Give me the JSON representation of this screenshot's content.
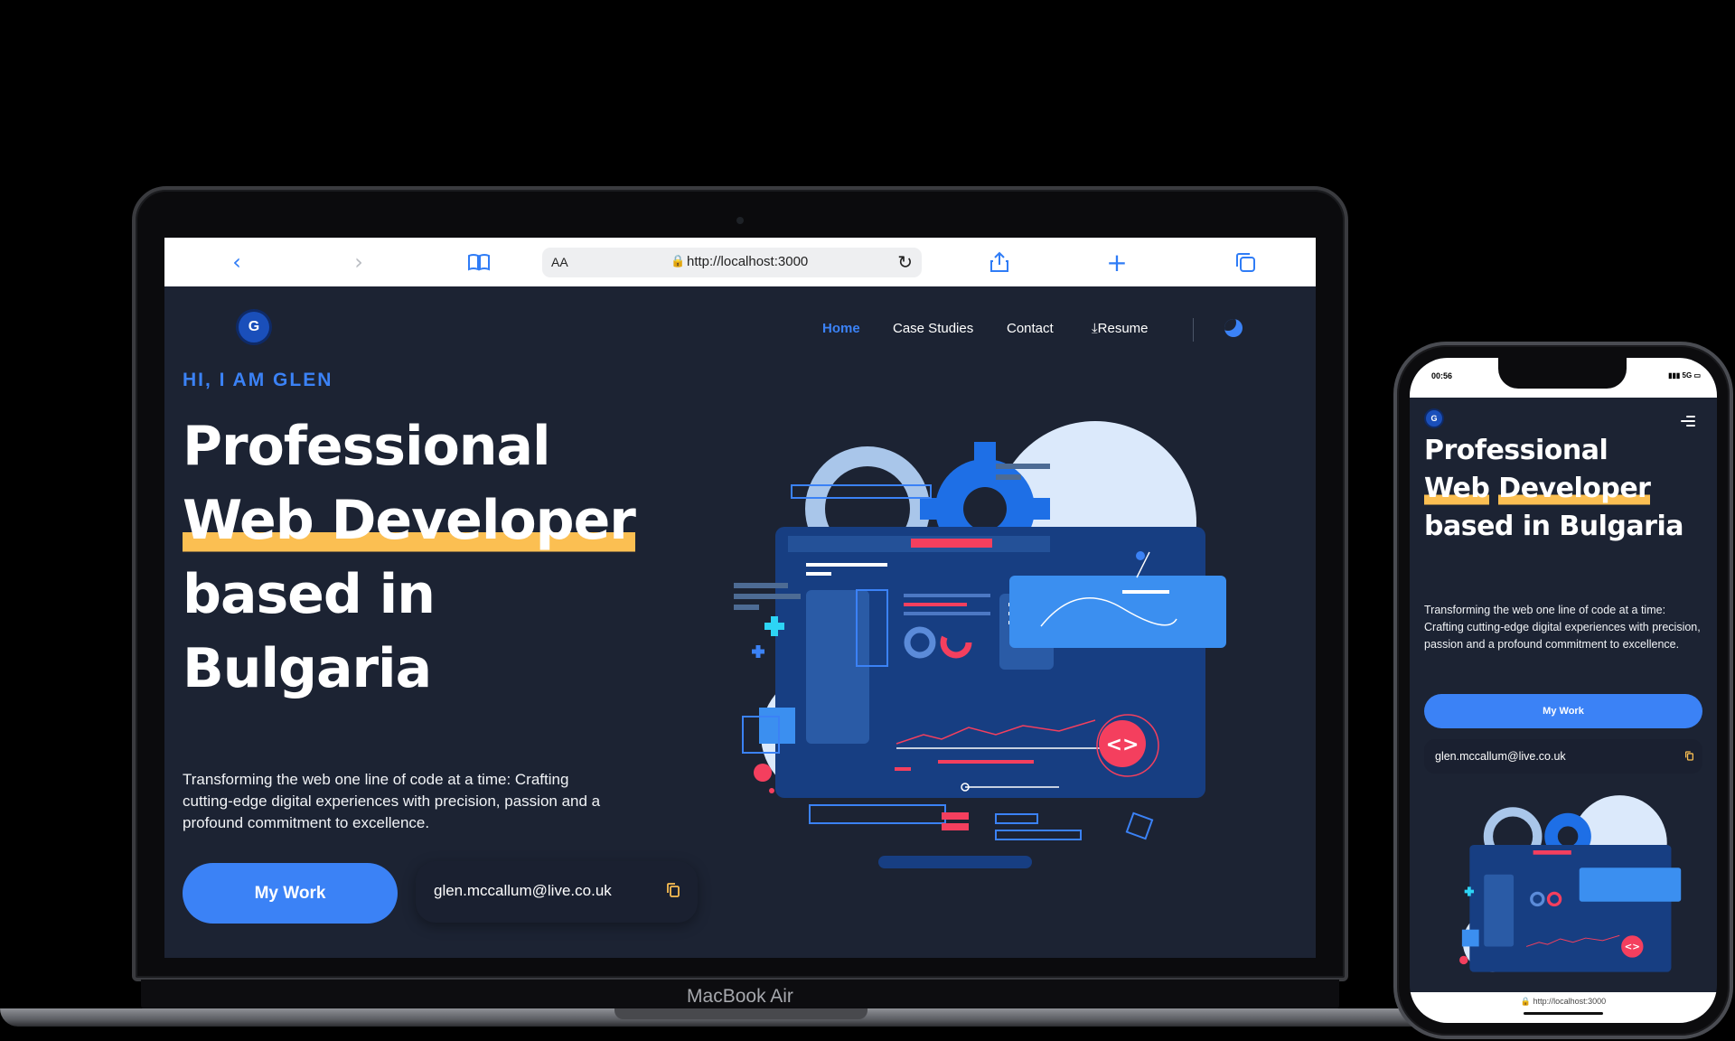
{
  "laptop": {
    "brand": "MacBook Air",
    "browser": {
      "reader_label": "AA",
      "url": "http://localhost:3000"
    },
    "nav": {
      "logo_letter": "G",
      "links": [
        "Home",
        "Case Studies",
        "Contact",
        "Resume"
      ],
      "active": "Home"
    },
    "hero": {
      "eyebrow": "HI, I AM GLEN",
      "line1": "Professional",
      "line2": "Web Developer",
      "line3": "based in",
      "line4": "Bulgaria",
      "paragraph": "Transforming the web one line of code at a time: Crafting cutting-edge digital experiences with precision, passion and a profound commitment to excellence.",
      "cta": "My Work",
      "email": "glen.mccallum@live.co.uk"
    }
  },
  "phone": {
    "time": "00:56",
    "signal": "5G",
    "logo_letter": "G",
    "line1": "Professional",
    "line2": "Web",
    "line3": "Developer",
    "line4": "based in Bulgaria",
    "paragraph": "Transforming the web one line of code at a time: Crafting cutting-edge digital experiences with precision, passion and a profound commitment to excellence.",
    "cta": "My Work",
    "email": "glen.mccallum@live.co.uk",
    "url": "http://localhost:3000"
  },
  "colors": {
    "page_bg": "#1c2333",
    "accent": "#3b82f6",
    "highlight": "#fbbf52",
    "code_badge": "#f43f5e"
  }
}
